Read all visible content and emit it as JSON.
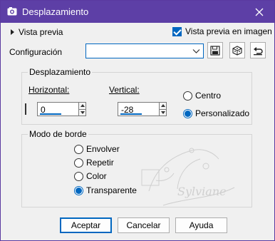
{
  "window": {
    "title": "Desplazamiento",
    "accent": "#5d3fa6"
  },
  "preview": {
    "label": "Vista previa",
    "live_label": "Vista previa en imagen",
    "live_checked": true
  },
  "config": {
    "label": "Configuración",
    "value": ""
  },
  "displacement": {
    "title": "Desplazamiento",
    "horizontal_label": "Horizontal:",
    "horizontal_value": "0",
    "vertical_label": "Vertical:",
    "vertical_value": "-28",
    "options": [
      {
        "label": "Centro",
        "selected": false
      },
      {
        "label": "Personalizado",
        "selected": true
      }
    ]
  },
  "edge_mode": {
    "title": "Modo de borde",
    "options": [
      {
        "label": "Envolver",
        "selected": false
      },
      {
        "label": "Repetir",
        "selected": false
      },
      {
        "label": "Color",
        "selected": false
      },
      {
        "label": "Transparente",
        "selected": true
      }
    ]
  },
  "watermark": {
    "text": "Sylviane"
  },
  "buttons": {
    "ok": "Aceptar",
    "cancel": "Cancelar",
    "help": "Ayuda"
  }
}
